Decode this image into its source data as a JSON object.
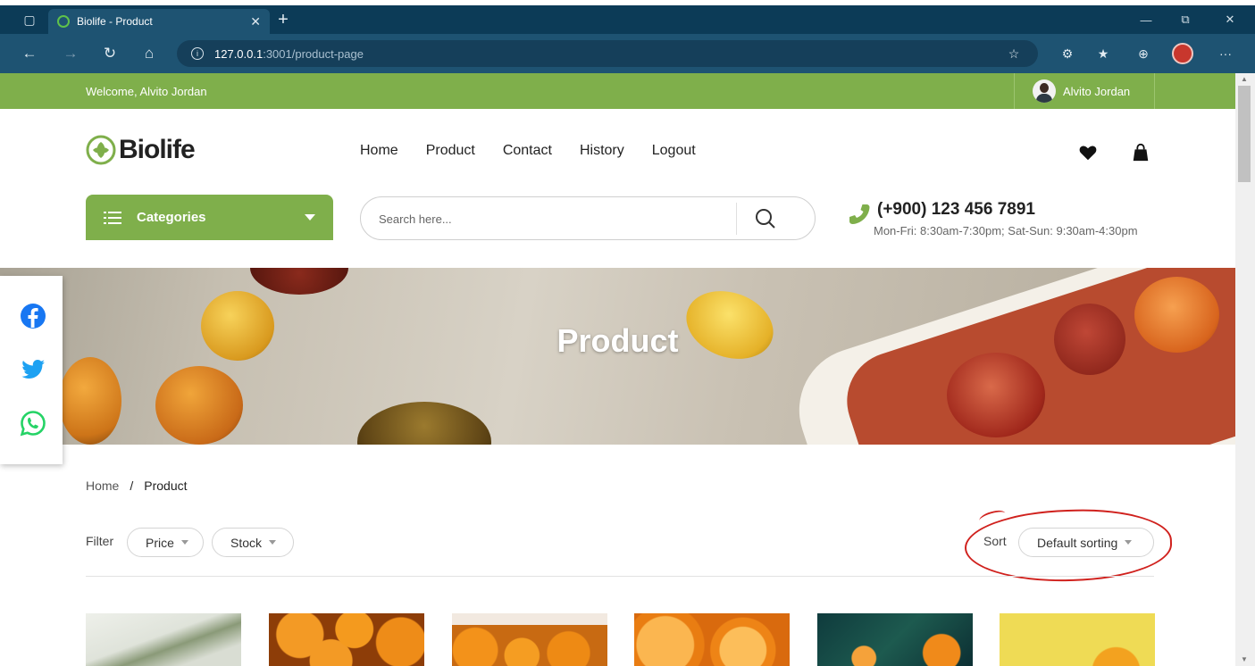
{
  "browser": {
    "tab_title": "Biolife - Product",
    "url_host": "127.0.0.1",
    "url_rest": ":3001/product-page",
    "icons": [
      "tab-actions-icon",
      "favicon",
      "tab-close-icon",
      "new-tab-icon",
      "back-icon",
      "forward-icon",
      "refresh-icon",
      "home-icon",
      "site-info-icon",
      "add-favorite-icon",
      "extensions-icon",
      "favorites-icon",
      "collections-icon",
      "profile-avatar",
      "more-icon",
      "minimize-icon",
      "restore-icon",
      "close-window-icon"
    ]
  },
  "top_bar": {
    "welcome": "Welcome, Alvito Jordan",
    "user_name": "Alvito Jordan",
    "color": "#7faf4b"
  },
  "header": {
    "brand": "Biolife",
    "nav": [
      "Home",
      "Product",
      "Contact",
      "History",
      "Logout"
    ],
    "icons": [
      "heart-icon",
      "shopping-bag-icon"
    ],
    "categories_label": "Categories",
    "search_placeholder": "Search here...",
    "phone": "(+900) 123 456 7891",
    "hours": "Mon-Fri: 8:30am-7:30pm; Sat-Sun: 9:30am-4:30pm"
  },
  "banner": {
    "title": "Product"
  },
  "social": [
    "facebook-icon",
    "twitter-icon",
    "whatsapp-icon"
  ],
  "breadcrumb": {
    "home": "Home",
    "separator": "/",
    "current": "Product"
  },
  "toolbar": {
    "filter_label": "Filter",
    "price": "Price",
    "stock": "Stock",
    "sort_label": "Sort",
    "sort_value": "Default sorting"
  },
  "products": [
    {
      "image": "plant-image"
    },
    {
      "image": "oranges-image"
    },
    {
      "image": "oranges-price-tag-image"
    },
    {
      "image": "orange-slices-image"
    },
    {
      "image": "oranges-leaves-image"
    },
    {
      "image": "yellow-citrus-image"
    }
  ]
}
